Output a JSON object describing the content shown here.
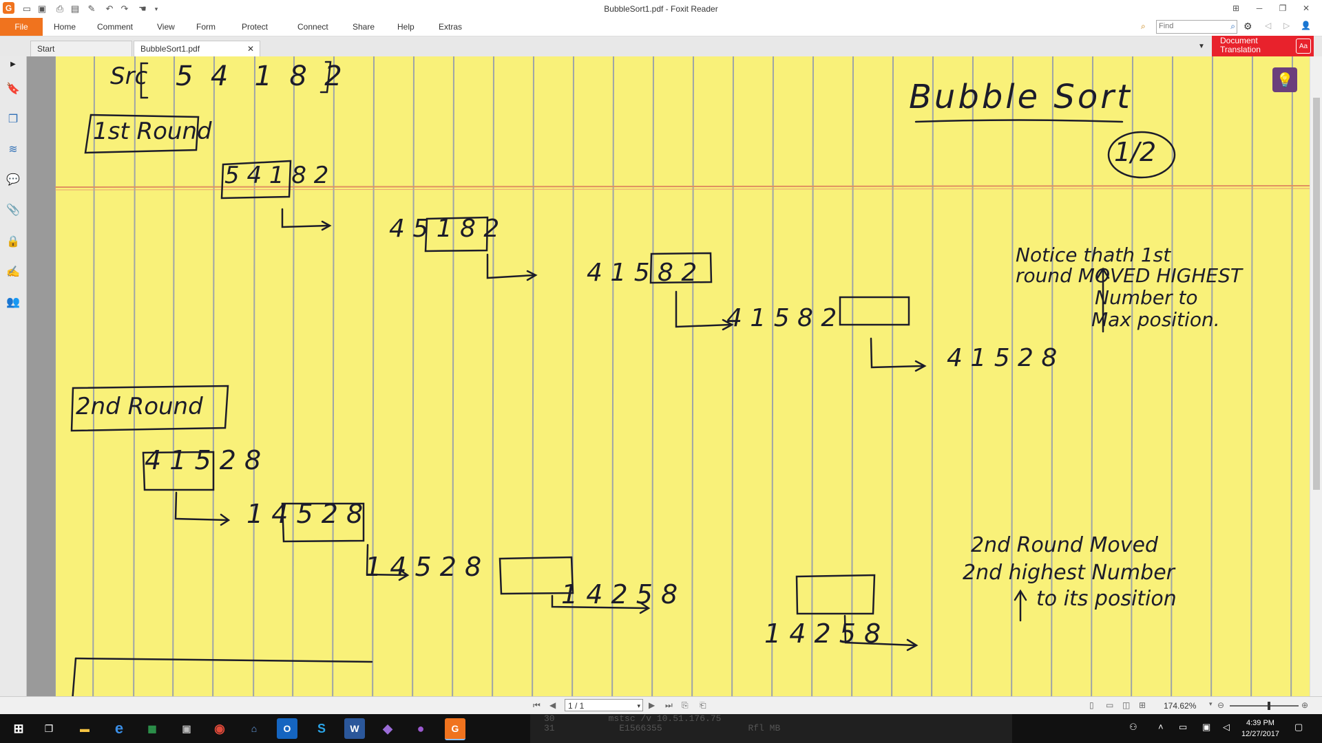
{
  "window": {
    "title": "BubbleSort1.pdf - Foxit Reader"
  },
  "menu": {
    "file": "File",
    "items": [
      "Home",
      "Comment",
      "View",
      "Form",
      "Protect",
      "Connect",
      "Share",
      "Help",
      "Extras"
    ]
  },
  "search": {
    "placeholder": "Find"
  },
  "tabs": [
    {
      "label": "Start"
    },
    {
      "label": "BubbleSort1.pdf"
    }
  ],
  "translation": {
    "label": "Document Translation"
  },
  "document": {
    "src_label": "Src",
    "src_values": "5  4   1  8  2",
    "title": "Bubble Sort",
    "page_marker": "1/2",
    "round1_label": "1st Round",
    "round1_steps": [
      "5 4 1 8 2",
      "4 5 1 8 2",
      "4 1 5 8 2",
      "4 1 5 8 2",
      "4 1 5 2 8"
    ],
    "note1": [
      "Notice thath 1st",
      "round MOVED HIGHEST",
      "Number to",
      "Max position."
    ],
    "round2_label": "2nd Round",
    "round2_steps": [
      "4 1 5 2 8",
      "1 4 5 2 8",
      "1 4 5 2 8",
      "1 4 2 5 8",
      "1 4 2 5 8"
    ],
    "note2": [
      "2nd Round Moved",
      "2nd highest Number",
      "to its position"
    ]
  },
  "status": {
    "page": "1 / 1",
    "zoom": "174.62%"
  },
  "taskbar": {
    "time": "4:39 PM",
    "date": "12/27/2017",
    "console_lines": [
      "30          mstsc /v 10.51.176.75",
      "31            E1566355                Rfl MB"
    ]
  },
  "colors": {
    "accent": "#f0731e",
    "paper": "#f9f179",
    "translation": "#e8222c",
    "ink": "#1c1c2a"
  }
}
